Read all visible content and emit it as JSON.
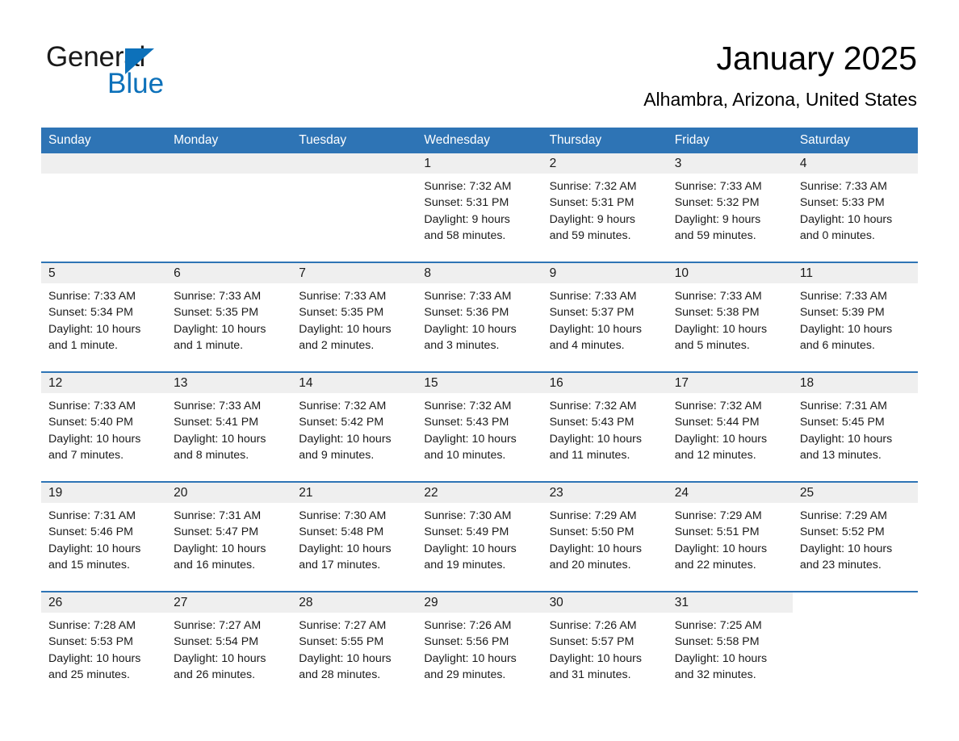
{
  "brand": {
    "name_part1": "General",
    "name_part2": "Blue",
    "accent_color": "#0d71ba"
  },
  "header": {
    "title": "January 2025",
    "subtitle": "Alhambra, Arizona, United States"
  },
  "theme": {
    "header_row_color": "#2e74b5",
    "daynum_bar_color": "#efefef",
    "text_color": "#1a1a1a"
  },
  "weekday_headers": [
    "Sunday",
    "Monday",
    "Tuesday",
    "Wednesday",
    "Thursday",
    "Friday",
    "Saturday"
  ],
  "weeks": [
    [
      {
        "day": "",
        "lines": []
      },
      {
        "day": "",
        "lines": []
      },
      {
        "day": "",
        "lines": []
      },
      {
        "day": "1",
        "lines": [
          "Sunrise: 7:32 AM",
          "Sunset: 5:31 PM",
          "Daylight: 9 hours",
          "and 58 minutes."
        ]
      },
      {
        "day": "2",
        "lines": [
          "Sunrise: 7:32 AM",
          "Sunset: 5:31 PM",
          "Daylight: 9 hours",
          "and 59 minutes."
        ]
      },
      {
        "day": "3",
        "lines": [
          "Sunrise: 7:33 AM",
          "Sunset: 5:32 PM",
          "Daylight: 9 hours",
          "and 59 minutes."
        ]
      },
      {
        "day": "4",
        "lines": [
          "Sunrise: 7:33 AM",
          "Sunset: 5:33 PM",
          "Daylight: 10 hours",
          "and 0 minutes."
        ]
      }
    ],
    [
      {
        "day": "5",
        "lines": [
          "Sunrise: 7:33 AM",
          "Sunset: 5:34 PM",
          "Daylight: 10 hours",
          "and 1 minute."
        ]
      },
      {
        "day": "6",
        "lines": [
          "Sunrise: 7:33 AM",
          "Sunset: 5:35 PM",
          "Daylight: 10 hours",
          "and 1 minute."
        ]
      },
      {
        "day": "7",
        "lines": [
          "Sunrise: 7:33 AM",
          "Sunset: 5:35 PM",
          "Daylight: 10 hours",
          "and 2 minutes."
        ]
      },
      {
        "day": "8",
        "lines": [
          "Sunrise: 7:33 AM",
          "Sunset: 5:36 PM",
          "Daylight: 10 hours",
          "and 3 minutes."
        ]
      },
      {
        "day": "9",
        "lines": [
          "Sunrise: 7:33 AM",
          "Sunset: 5:37 PM",
          "Daylight: 10 hours",
          "and 4 minutes."
        ]
      },
      {
        "day": "10",
        "lines": [
          "Sunrise: 7:33 AM",
          "Sunset: 5:38 PM",
          "Daylight: 10 hours",
          "and 5 minutes."
        ]
      },
      {
        "day": "11",
        "lines": [
          "Sunrise: 7:33 AM",
          "Sunset: 5:39 PM",
          "Daylight: 10 hours",
          "and 6 minutes."
        ]
      }
    ],
    [
      {
        "day": "12",
        "lines": [
          "Sunrise: 7:33 AM",
          "Sunset: 5:40 PM",
          "Daylight: 10 hours",
          "and 7 minutes."
        ]
      },
      {
        "day": "13",
        "lines": [
          "Sunrise: 7:33 AM",
          "Sunset: 5:41 PM",
          "Daylight: 10 hours",
          "and 8 minutes."
        ]
      },
      {
        "day": "14",
        "lines": [
          "Sunrise: 7:32 AM",
          "Sunset: 5:42 PM",
          "Daylight: 10 hours",
          "and 9 minutes."
        ]
      },
      {
        "day": "15",
        "lines": [
          "Sunrise: 7:32 AM",
          "Sunset: 5:43 PM",
          "Daylight: 10 hours",
          "and 10 minutes."
        ]
      },
      {
        "day": "16",
        "lines": [
          "Sunrise: 7:32 AM",
          "Sunset: 5:43 PM",
          "Daylight: 10 hours",
          "and 11 minutes."
        ]
      },
      {
        "day": "17",
        "lines": [
          "Sunrise: 7:32 AM",
          "Sunset: 5:44 PM",
          "Daylight: 10 hours",
          "and 12 minutes."
        ]
      },
      {
        "day": "18",
        "lines": [
          "Sunrise: 7:31 AM",
          "Sunset: 5:45 PM",
          "Daylight: 10 hours",
          "and 13 minutes."
        ]
      }
    ],
    [
      {
        "day": "19",
        "lines": [
          "Sunrise: 7:31 AM",
          "Sunset: 5:46 PM",
          "Daylight: 10 hours",
          "and 15 minutes."
        ]
      },
      {
        "day": "20",
        "lines": [
          "Sunrise: 7:31 AM",
          "Sunset: 5:47 PM",
          "Daylight: 10 hours",
          "and 16 minutes."
        ]
      },
      {
        "day": "21",
        "lines": [
          "Sunrise: 7:30 AM",
          "Sunset: 5:48 PM",
          "Daylight: 10 hours",
          "and 17 minutes."
        ]
      },
      {
        "day": "22",
        "lines": [
          "Sunrise: 7:30 AM",
          "Sunset: 5:49 PM",
          "Daylight: 10 hours",
          "and 19 minutes."
        ]
      },
      {
        "day": "23",
        "lines": [
          "Sunrise: 7:29 AM",
          "Sunset: 5:50 PM",
          "Daylight: 10 hours",
          "and 20 minutes."
        ]
      },
      {
        "day": "24",
        "lines": [
          "Sunrise: 7:29 AM",
          "Sunset: 5:51 PM",
          "Daylight: 10 hours",
          "and 22 minutes."
        ]
      },
      {
        "day": "25",
        "lines": [
          "Sunrise: 7:29 AM",
          "Sunset: 5:52 PM",
          "Daylight: 10 hours",
          "and 23 minutes."
        ]
      }
    ],
    [
      {
        "day": "26",
        "lines": [
          "Sunrise: 7:28 AM",
          "Sunset: 5:53 PM",
          "Daylight: 10 hours",
          "and 25 minutes."
        ]
      },
      {
        "day": "27",
        "lines": [
          "Sunrise: 7:27 AM",
          "Sunset: 5:54 PM",
          "Daylight: 10 hours",
          "and 26 minutes."
        ]
      },
      {
        "day": "28",
        "lines": [
          "Sunrise: 7:27 AM",
          "Sunset: 5:55 PM",
          "Daylight: 10 hours",
          "and 28 minutes."
        ]
      },
      {
        "day": "29",
        "lines": [
          "Sunrise: 7:26 AM",
          "Sunset: 5:56 PM",
          "Daylight: 10 hours",
          "and 29 minutes."
        ]
      },
      {
        "day": "30",
        "lines": [
          "Sunrise: 7:26 AM",
          "Sunset: 5:57 PM",
          "Daylight: 10 hours",
          "and 31 minutes."
        ]
      },
      {
        "day": "31",
        "lines": [
          "Sunrise: 7:25 AM",
          "Sunset: 5:58 PM",
          "Daylight: 10 hours",
          "and 32 minutes."
        ]
      },
      {
        "day": "",
        "lines": []
      }
    ]
  ]
}
